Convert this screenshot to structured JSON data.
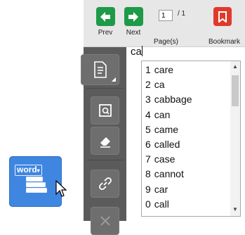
{
  "word_tool": {
    "label": "word",
    "icon": "word-dropdown-icon"
  },
  "toolbar": {
    "prev_label": "Prev",
    "next_label": "Next",
    "page_value": "1",
    "page_total": "/ 1",
    "page_label": "Page(s)",
    "bookmark_label": "Bookmark"
  },
  "editor": {
    "typed_text": "ca"
  },
  "suggestions": [
    {
      "num": "1",
      "word": "care"
    },
    {
      "num": "2",
      "word": "ca"
    },
    {
      "num": "3",
      "word": "cabbage"
    },
    {
      "num": "4",
      "word": "can"
    },
    {
      "num": "5",
      "word": "came"
    },
    {
      "num": "6",
      "word": "called"
    },
    {
      "num": "7",
      "word": "case"
    },
    {
      "num": "8",
      "word": "cannot"
    },
    {
      "num": "9",
      "word": "car"
    },
    {
      "num": "0",
      "word": "call"
    }
  ],
  "colors": {
    "nav_green": "#1e9a48",
    "bookmark_red": "#e03a2b",
    "sidebar": "#5b5b5b",
    "word_tool_blue": "#3f86e0"
  }
}
